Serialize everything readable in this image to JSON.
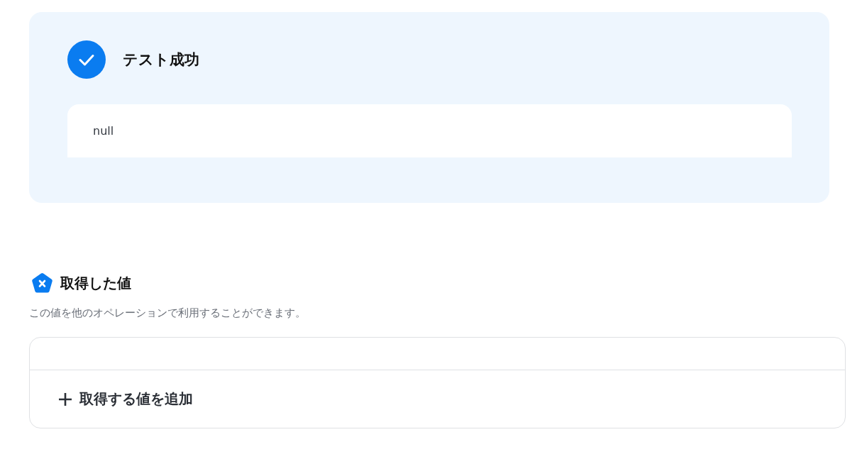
{
  "test_result": {
    "passed": true,
    "title": "テスト成功",
    "output": "null"
  },
  "retrieved_values": {
    "title": "取得した値",
    "description": "この値を他のオペレーションで利用することができます。",
    "add_button": {
      "label": "取得する値を追加"
    }
  }
}
